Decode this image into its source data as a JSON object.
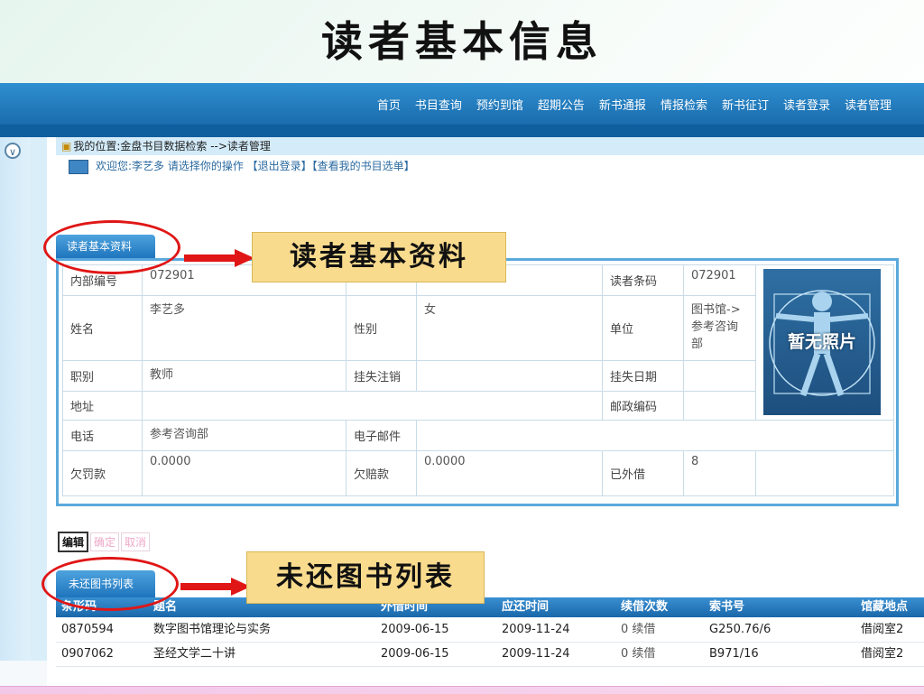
{
  "slide_title": "读者基本信息",
  "nav": [
    "首页",
    "书目查询",
    "预约到馆",
    "超期公告",
    "新书通报",
    "情报检索",
    "新书征订",
    "读者登录",
    "读者管理"
  ],
  "breadcrumb": "我的位置:金盘书目数据检索 -->读者管理",
  "welcome": "欢迎您:李艺多 请选择你的操作 【退出登录】【查看我的书目选单】",
  "tab_basic": "读者基本资料",
  "callout_basic": "读者基本资料",
  "info": {
    "internal_id_label": "内部编号",
    "internal_id": "072901",
    "barcode_label": "读者条码",
    "barcode": "072901",
    "name_label": "姓名",
    "name": "李艺多",
    "gender_label": "性别",
    "gender": "女",
    "unit_label": "单位",
    "unit": "图书馆->参考咨询部",
    "title_label": "职别",
    "title": "教师",
    "loss_cancel_label": "挂失注销",
    "loss_date_label": "挂失日期",
    "address_label": "地址",
    "postcode_label": "邮政编码",
    "phone_label": "电话",
    "phone": "参考咨询部",
    "email_label": "电子邮件",
    "fine_label": "欠罚款",
    "fine": "0.0000",
    "compensation_label": "欠赔款",
    "compensation": "0.0000",
    "borrowed_label": "已外借",
    "borrowed": "8",
    "photo_text": "暂无照片"
  },
  "buttons": {
    "edit": "编辑",
    "confirm": "确定",
    "cancel": "取消"
  },
  "tab_loans": "未还图书列表",
  "callout_loans": "未还图书列表",
  "loans": {
    "headers": [
      "条形码",
      "题名",
      "外借时间",
      "应还时间",
      "续借次数",
      "索书号",
      "馆藏地点"
    ],
    "rows": [
      [
        "0870594",
        "数字图书馆理论与实务",
        "2009-06-15",
        "2009-11-24",
        "0 续借",
        "G250.76/6",
        "借阅室2"
      ],
      [
        "0907062",
        "圣经文学二十讲",
        "2009-06-15",
        "2009-11-24",
        "0 续借",
        "B971/16",
        "借阅室2"
      ]
    ]
  },
  "colors": {
    "nav_blue": "#1a6cad",
    "callout_bg": "#f9db8e",
    "ring_red": "#e01616"
  }
}
